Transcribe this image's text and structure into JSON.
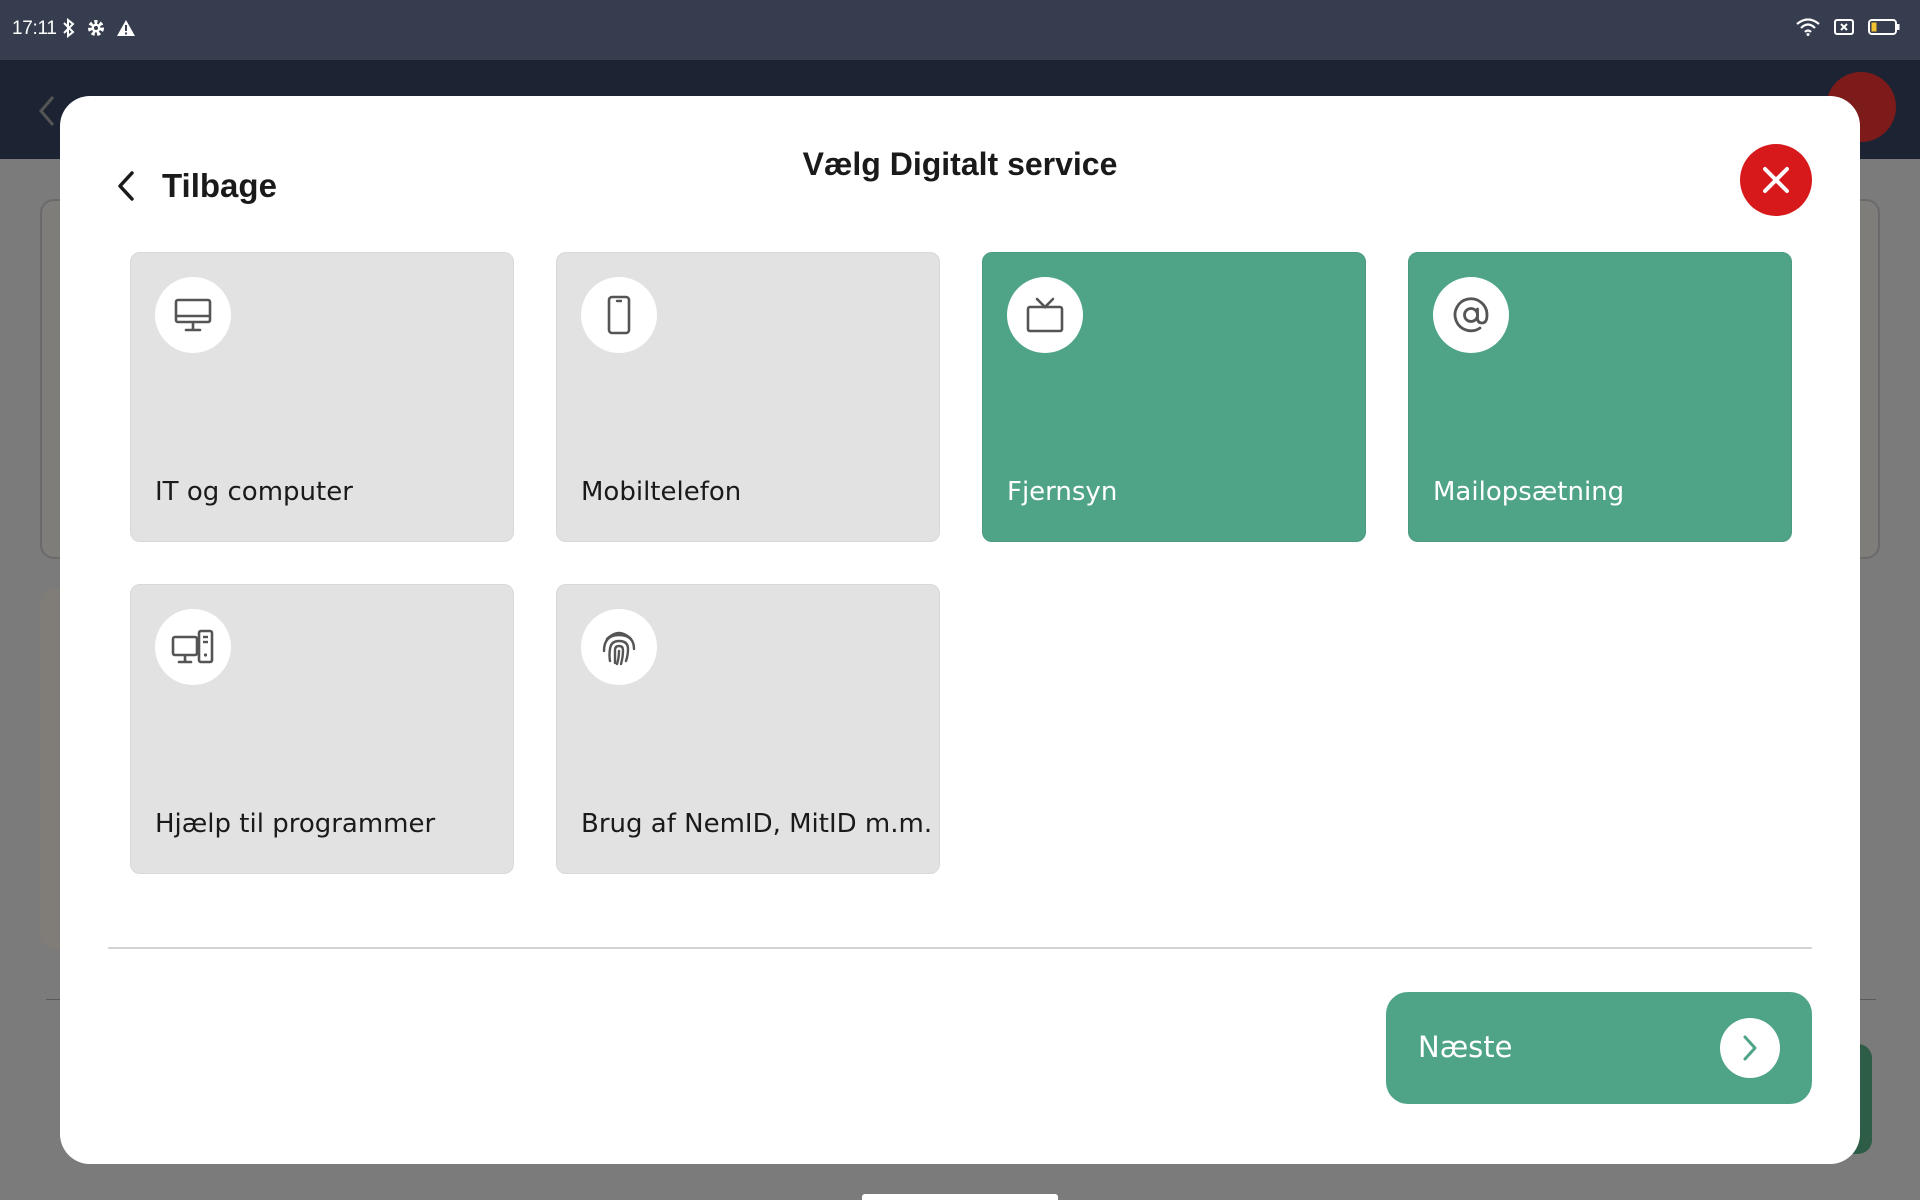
{
  "status_bar": {
    "time": "17:11",
    "left_icons": [
      "bluetooth-icon",
      "settings-icon",
      "warning-icon"
    ],
    "right_icons": [
      "wifi-icon",
      "sim-icon",
      "battery-icon"
    ]
  },
  "colors": {
    "selected_tile": "#4fa487",
    "unselected_tile": "#e2e2e2",
    "close_button": "#d7191c",
    "next_button": "#4fa487"
  },
  "modal": {
    "back_label": "Tilbage",
    "title": "Vælg Digitalt service",
    "tiles": [
      {
        "label": "IT og computer",
        "icon": "monitor-icon",
        "selected": false
      },
      {
        "label": "Mobiltelefon",
        "icon": "smartphone-icon",
        "selected": false
      },
      {
        "label": "Fjernsyn",
        "icon": "tv-icon",
        "selected": true
      },
      {
        "label": "Mailopsætning",
        "icon": "at-sign-icon",
        "selected": true
      },
      {
        "label": "Hjælp til programmer",
        "icon": "desktop-tower-icon",
        "selected": false
      },
      {
        "label": "Brug af NemID, MitID m.m.",
        "icon": "fingerprint-icon",
        "selected": false
      }
    ],
    "next_label": "Næste"
  }
}
